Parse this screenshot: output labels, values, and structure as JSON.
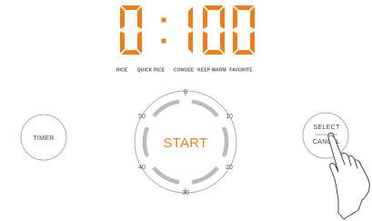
{
  "display": {
    "time_digits": [
      "0",
      "1",
      "0",
      "0"
    ],
    "color": "#f07d16"
  },
  "modes": [
    {
      "label": "RICE",
      "active": true
    },
    {
      "label": "QUICK RICE",
      "active": false
    },
    {
      "label": "CONGEE",
      "active": false
    },
    {
      "label": "KEEP WARM",
      "active": false
    },
    {
      "label": "FAVORITE",
      "active": false
    }
  ],
  "dial": {
    "ticks": [
      "0",
      "10",
      "20",
      "30",
      "40",
      "50"
    ],
    "start_label": "START",
    "accent": "#f07d16",
    "ring_color": "#bbbbbb"
  },
  "buttons": {
    "timer_label": "TIMER",
    "select_label": "SELECT",
    "cancel_label": "CANCEL"
  },
  "gesture": {
    "icon": "hand-pointer-icon"
  }
}
